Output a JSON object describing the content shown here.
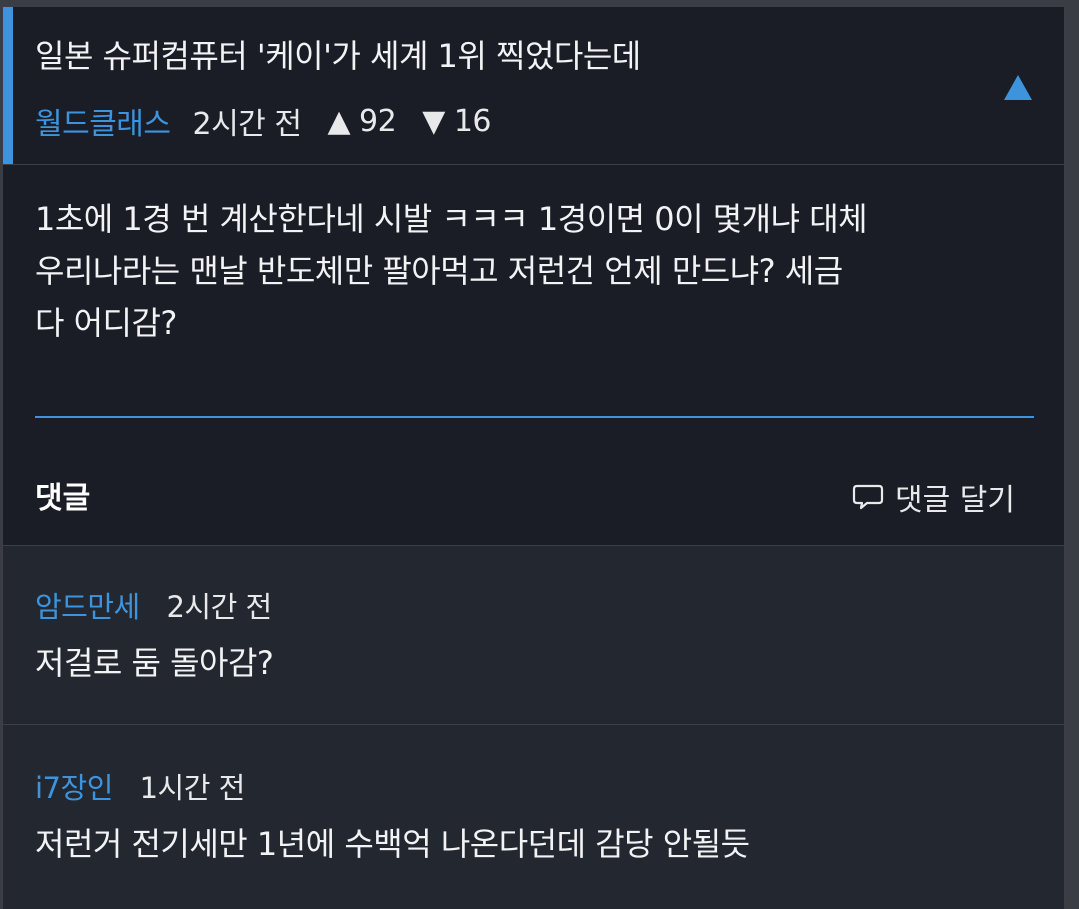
{
  "post": {
    "title": "일본 슈퍼컴퓨터 '케이'가 세계 1위 찍었다는데",
    "author": "월드클래스",
    "time": "2시간 전",
    "upvotes": "▲ 92",
    "downvotes": "▼ 16",
    "body_lines": [
      "1초에 1경 번 계산한다네 시발 ㅋㅋㅋ 1경이면 0이 몇개냐 대체",
      "우리나라는 맨날 반도체만 팔아먹고 저런건 언제 만드냐? 세금",
      "다 어디감?"
    ]
  },
  "comments_section": {
    "header": "댓글",
    "write_label": "댓글 달기"
  },
  "comments": [
    {
      "author": "암드만세",
      "time": "2시간 전",
      "text": "저걸로 둠 돌아감?"
    },
    {
      "author": "i7장인",
      "time": "1시간 전",
      "text": "저런거 전기세만 1년에 수백억 나온다던데 감당 안될듯"
    }
  ],
  "colors": {
    "accent": "#3d94dc",
    "background": "#1a1d26",
    "comment_background": "#232730"
  },
  "icons": [
    "collapse-up-icon",
    "speech-bubble-icon"
  ]
}
